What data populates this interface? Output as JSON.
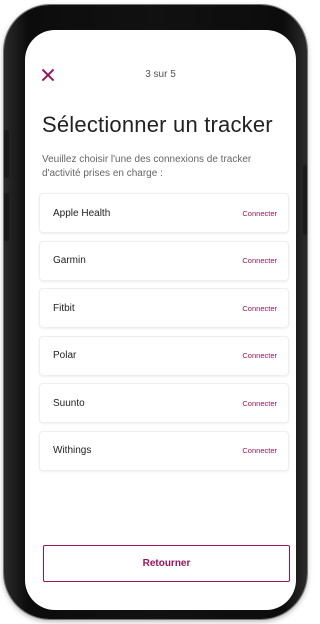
{
  "header": {
    "step_label": "3 sur 5"
  },
  "main": {
    "title": "Sélectionner un tracker",
    "subtitle": "Veuillez choisir l'une des connexions de tracker d'activité prises en charge :"
  },
  "trackers": [
    {
      "name": "Apple Health",
      "action": "Connecter"
    },
    {
      "name": "Garmin",
      "action": "Connecter"
    },
    {
      "name": "Fitbit",
      "action": "Connecter"
    },
    {
      "name": "Polar",
      "action": "Connecter"
    },
    {
      "name": "Suunto",
      "action": "Connecter"
    },
    {
      "name": "Withings",
      "action": "Connecter"
    }
  ],
  "footer": {
    "back_label": "Retourner"
  },
  "colors": {
    "accent": "#9b1458",
    "text": "#222222",
    "muted": "#666666"
  }
}
